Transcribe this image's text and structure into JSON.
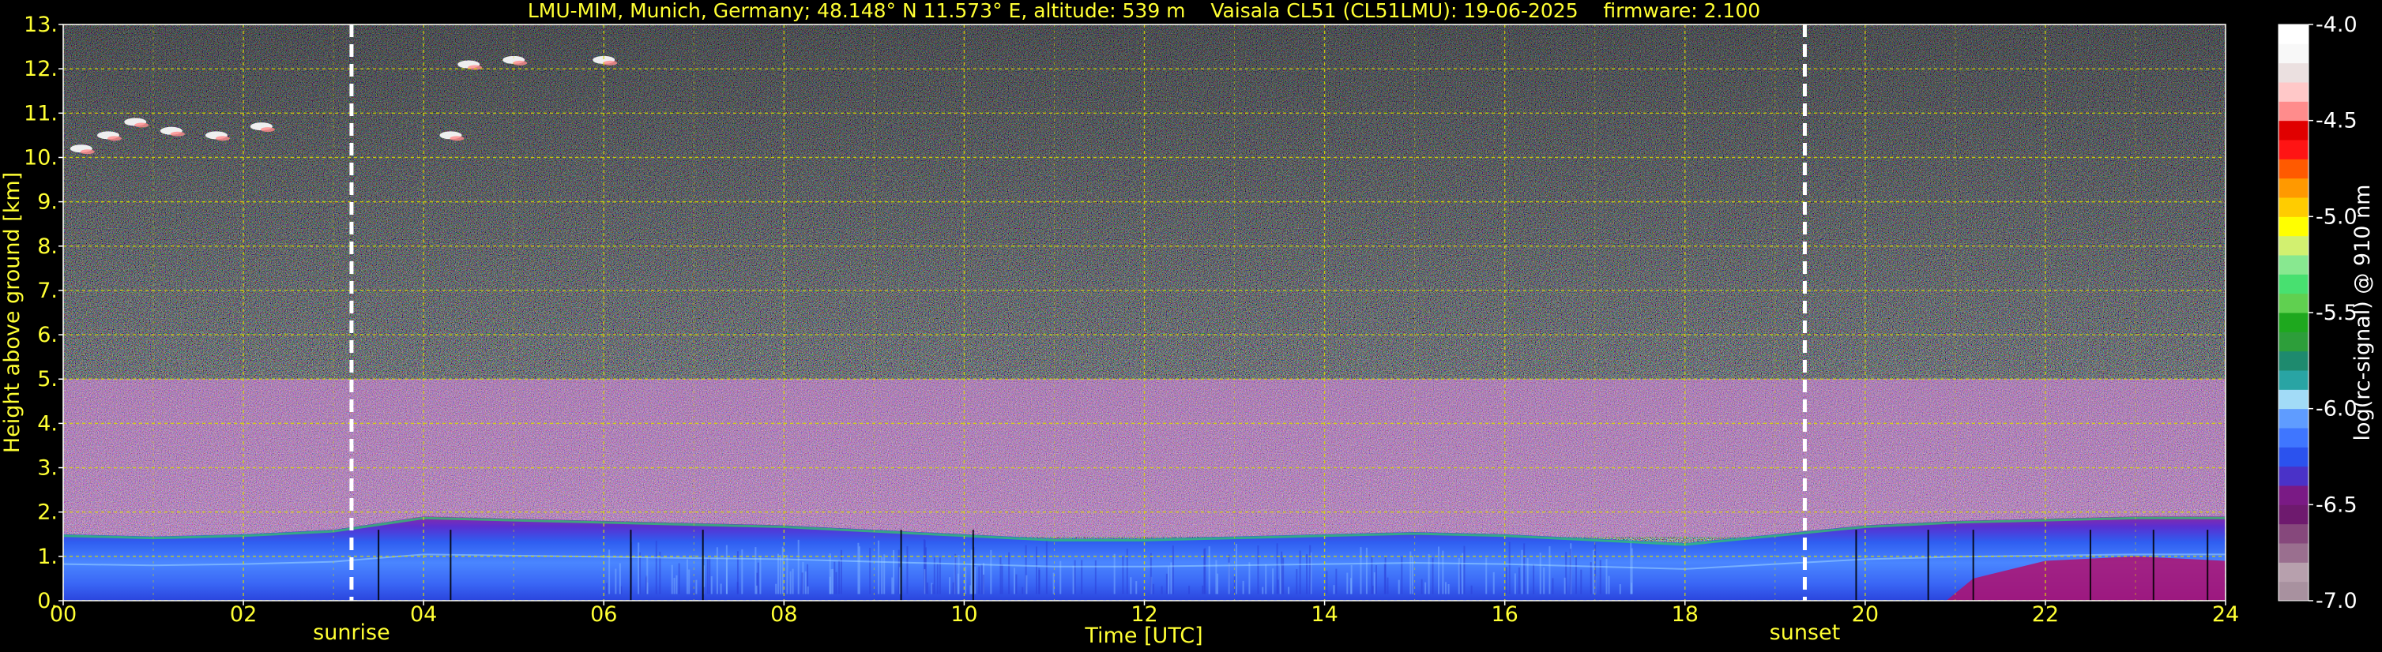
{
  "chart_data": {
    "type": "heatmap",
    "title": "LMU-MIM, Munich, Germany; 48.148° N 11.573° E, altitude: 539 m    Vaisala CL51 (CL51LMU): 19-06-2025    firmware: 2.100",
    "xlabel": "Time [UTC]",
    "ylabel": "Height above ground [km]",
    "xlim": [
      0,
      24
    ],
    "ylim": [
      0,
      13
    ],
    "x_ticks": [
      0,
      2,
      4,
      6,
      8,
      10,
      12,
      14,
      16,
      18,
      20,
      22,
      24
    ],
    "x_tick_labels": [
      "00",
      "02",
      "04",
      "06",
      "08",
      "10",
      "12",
      "14",
      "16",
      "18",
      "20",
      "22",
      "24"
    ],
    "y_ticks": [
      0,
      1,
      2,
      3,
      4,
      5,
      6,
      7,
      8,
      9,
      10,
      11,
      12,
      13
    ],
    "y_tick_labels": [
      "0.",
      "1.",
      "2.",
      "3.",
      "4.",
      "5.",
      "6.",
      "7.",
      "8.",
      "9.",
      "10.",
      "11.",
      "12.",
      "13."
    ],
    "grid": true,
    "markers": [
      {
        "label": "sunrise",
        "x": 3.2
      },
      {
        "label": "sunset",
        "x": 19.33
      }
    ],
    "colorbar": {
      "label": "log(rc-signal) @ 910 nm",
      "range": [
        -7.0,
        -4.0
      ],
      "ticks": [
        -4.0,
        -4.5,
        -5.0,
        -5.5,
        -6.0,
        -6.5,
        -7.0
      ],
      "tick_labels": [
        "-4.0",
        "-4.5",
        "-5.0",
        "-5.5",
        "-6.0",
        "-6.5",
        "-7.0"
      ],
      "colors": [
        "#a8919f",
        "#b7a0ad",
        "#9a6f8f",
        "#86487c",
        "#6e1a6e",
        "#7a1a85",
        "#4a32c8",
        "#2b52ee",
        "#3f76ff",
        "#5f9cff",
        "#a2dbf7",
        "#29a4a4",
        "#1e8a6e",
        "#2d9e3a",
        "#1ea81e",
        "#60d050",
        "#48e070",
        "#88e890",
        "#d2f070",
        "#ffff00",
        "#ffcc00",
        "#ff9900",
        "#ff5a00",
        "#ff1414",
        "#e00000",
        "#ff8c8c",
        "#ffc8c8",
        "#ebe0e0",
        "#f8f8f8",
        "#ffffff"
      ]
    },
    "series": [
      {
        "name": "boundary layer top",
        "x": [
          0,
          1,
          2,
          3,
          4,
          5,
          6,
          7,
          8,
          9,
          10,
          11,
          12,
          13,
          14,
          15,
          16,
          17,
          18,
          19,
          20,
          21,
          22,
          23,
          24
        ],
        "y": [
          1.5,
          1.45,
          1.5,
          1.6,
          1.9,
          1.85,
          1.8,
          1.75,
          1.7,
          1.6,
          1.5,
          1.4,
          1.4,
          1.45,
          1.5,
          1.55,
          1.5,
          1.4,
          1.3,
          1.5,
          1.7,
          1.8,
          1.85,
          1.9,
          1.9
        ]
      },
      {
        "name": "cirrus cloud",
        "x": [
          0.2,
          0.5,
          0.8,
          1.2,
          1.7,
          2.2,
          4.3,
          4.5,
          5.0,
          6.0
        ],
        "y": [
          10.2,
          10.5,
          10.8,
          10.6,
          10.5,
          10.7,
          10.5,
          12.1,
          12.2,
          12.2
        ]
      }
    ]
  }
}
